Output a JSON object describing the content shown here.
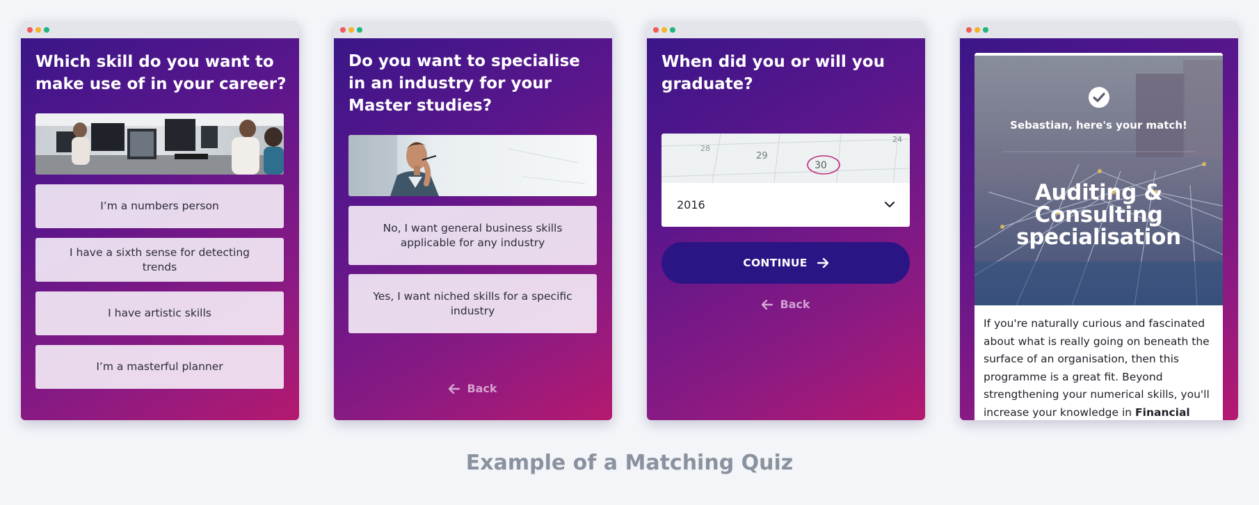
{
  "colors": {
    "page_bg": "#f3f5f9",
    "dot_red": "#ef5a5a",
    "dot_yellow": "#f5b326",
    "dot_green": "#21b67f",
    "gradient_start": "#3a1688",
    "gradient_end": "#b5196f",
    "continue_button": "#2b1585",
    "caption": "#8a929f"
  },
  "screen1": {
    "question": "Which skill do you want to make use of in your career?",
    "options": [
      "I’m a numbers person",
      "I have a sixth sense for detecting trends",
      "I have artistic skills",
      "I’m a masterful planner"
    ]
  },
  "screen2": {
    "question": "Do you want to specialise in an industry for your Master studies?",
    "options": [
      "No, I want general business skills applicable for any industry",
      "Yes, I want niched skills for a specific industry"
    ],
    "back_label": "Back"
  },
  "screen3": {
    "question": "When did you or will you graduate?",
    "calendar_days": [
      "29",
      "30",
      "24",
      "28"
    ],
    "year_select": {
      "selected": "2016"
    },
    "continue_label": "CONTINUE",
    "back_label": "Back"
  },
  "screen4": {
    "match_text": "Sebastian, here's your match!",
    "specialisation_title": "Auditing & Consulting specialisation",
    "body_intro": "If you're naturally curious and fascinated about what is really going on beneath the surface of an organisation, then this programme is a great fit. Beyond strengthening your numerical skills, you'll increase your knowledge in ",
    "body_bold": "Financial"
  },
  "caption": "Example of a Matching Quiz",
  "icons": {
    "back": "arrow-left-icon",
    "continue": "arrow-right-icon",
    "select": "chevron-down-icon",
    "match": "checkmark-circle-icon"
  }
}
